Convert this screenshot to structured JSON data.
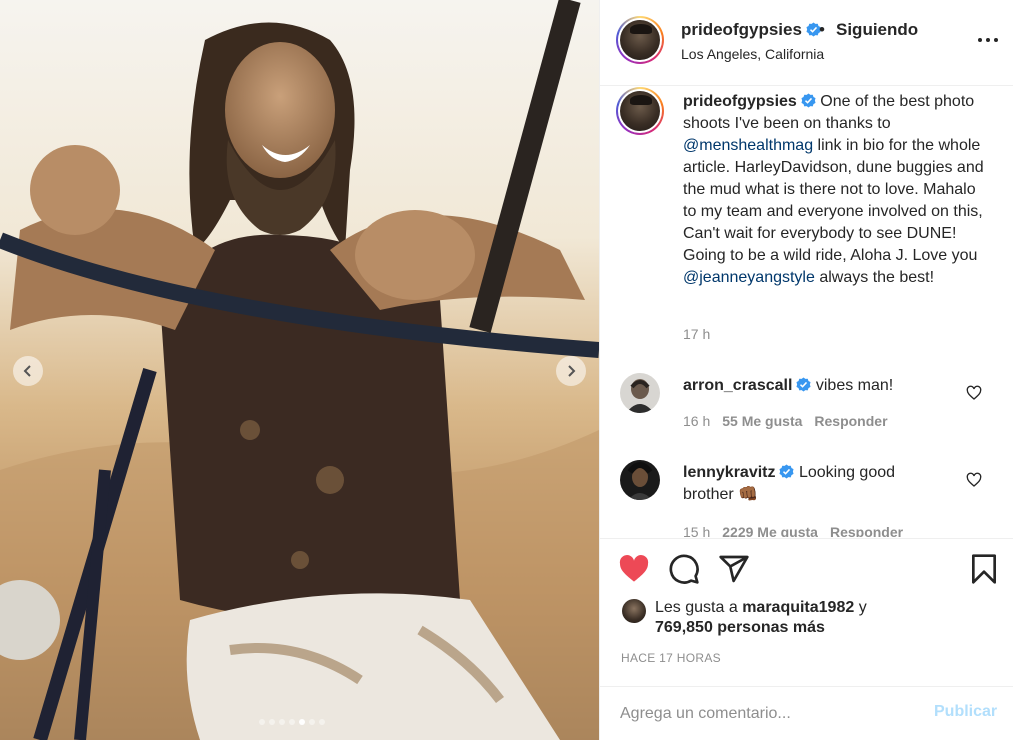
{
  "post": {
    "username": "prideofgypsies",
    "follow_separator": "•",
    "follow_status": "Siguiendo",
    "location": "Los Angeles, California",
    "verified_color": "#3897f0"
  },
  "caption": {
    "username": "prideofgypsies",
    "text_1": "One of the best photo shoots I've been on thanks to",
    "mention_1": "@menshealthmag",
    "text_2": "link in bio for the whole article. HarleyDavidson, dune buggies and the mud what is there not to love. Mahalo to my team and everyone involved on this, Can't wait for everybody to see DUNE! Going to be a wild ride, Aloha J. Love you",
    "mention_2": "@jeanneyangstyle",
    "text_3": "always the best!",
    "time": "17 h"
  },
  "comments": [
    {
      "username": "arron_crascall",
      "text": "vibes man!",
      "time": "16 h",
      "likes": "55 Me gusta",
      "reply_label": "Responder"
    },
    {
      "username": "lennykravitz",
      "text": "Looking good brother",
      "emoji": "👊🏾",
      "time": "15 h",
      "likes": "2229 Me gusta",
      "reply_label": "Responder"
    }
  ],
  "actions": {
    "liked": true,
    "like_color": "#ed4956",
    "likes_prefix": "Les gusta a",
    "likes_user": "maraquita1982",
    "likes_joiner": "y",
    "likes_others": "769,850 personas más",
    "post_age": "HACE 17 HORAS"
  },
  "comment_box": {
    "placeholder": "Agrega un comentario...",
    "post_label": "Publicar",
    "post_color": "#b2dffc"
  },
  "carousel": {
    "total_slides": 7,
    "active_slide": 5
  },
  "icons": {
    "header_more": "more-options-icon",
    "like": "heart-filled-icon",
    "comment": "speech-bubble-icon",
    "share": "paper-plane-icon",
    "save": "bookmark-icon",
    "comment_like": "heart-outline-icon",
    "prev": "chevron-left-icon",
    "next": "chevron-right-icon"
  }
}
